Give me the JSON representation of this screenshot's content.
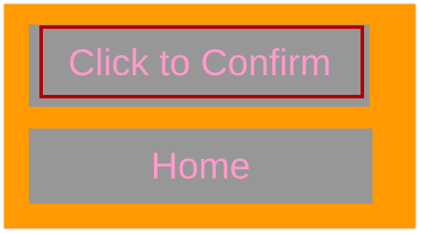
{
  "colors": {
    "panel_bg": "#ff9a00",
    "button_bg": "#979797",
    "button_text": "#ff99cc",
    "focus_outline": "#b30000"
  },
  "buttons": {
    "confirm_label": "Click to Confirm",
    "home_label": "Home"
  }
}
